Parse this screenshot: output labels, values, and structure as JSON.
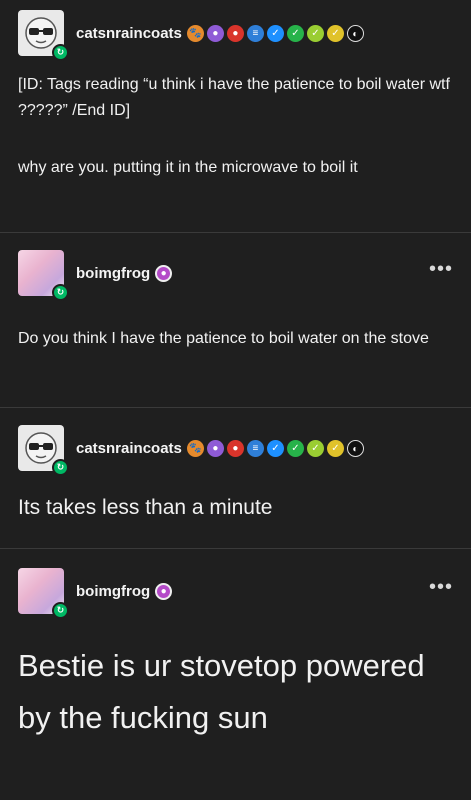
{
  "posts": [
    {
      "username": "catsnraincoats",
      "badges": [
        {
          "icon": "paw-badge-icon",
          "color": "#e58a2d",
          "glyph": "🐾"
        },
        {
          "icon": "purple-circle-badge-icon",
          "color": "#8f5bd6",
          "glyph": "●"
        },
        {
          "icon": "red-sticker-badge-icon",
          "color": "#d9342b",
          "glyph": "●"
        },
        {
          "icon": "blue-stack-badge-icon",
          "color": "#2f7fd8",
          "glyph": "≡"
        },
        {
          "icon": "blue-check-badge-icon",
          "color": "#1e90ff",
          "glyph": "✓"
        },
        {
          "icon": "green-check-badge-icon",
          "color": "#27b34a",
          "glyph": "✓"
        },
        {
          "icon": "lime-check-badge-icon",
          "color": "#9acd32",
          "glyph": "✓"
        },
        {
          "icon": "yellow-check-badge-icon",
          "color": "#e0c22a",
          "glyph": "✓"
        },
        {
          "icon": "moon-badge-icon",
          "color": "#111111",
          "glyph": "◐"
        }
      ],
      "paragraphs": [
        "[ID: Tags reading “u think i have the patience to boil water wtf ?????” /End ID]",
        "why are you. putting it in the microwave to boil it"
      ]
    },
    {
      "username": "boimgfrog",
      "badges": [
        {
          "icon": "pink-ghost-badge-icon",
          "color": "#b44ac8",
          "glyph": "●"
        }
      ],
      "paragraphs": [
        "Do you think I have the patience to boil water on the stove"
      ]
    },
    {
      "username": "catsnraincoats",
      "badges": [
        {
          "icon": "paw-badge-icon",
          "color": "#e58a2d",
          "glyph": "🐾"
        },
        {
          "icon": "purple-circle-badge-icon",
          "color": "#8f5bd6",
          "glyph": "●"
        },
        {
          "icon": "red-sticker-badge-icon",
          "color": "#d9342b",
          "glyph": "●"
        },
        {
          "icon": "blue-stack-badge-icon",
          "color": "#2f7fd8",
          "glyph": "≡"
        },
        {
          "icon": "blue-check-badge-icon",
          "color": "#1e90ff",
          "glyph": "✓"
        },
        {
          "icon": "green-check-badge-icon",
          "color": "#27b34a",
          "glyph": "✓"
        },
        {
          "icon": "lime-check-badge-icon",
          "color": "#9acd32",
          "glyph": "✓"
        },
        {
          "icon": "yellow-check-badge-icon",
          "color": "#e0c22a",
          "glyph": "✓"
        },
        {
          "icon": "moon-badge-icon",
          "color": "#111111",
          "glyph": "◐"
        }
      ],
      "paragraphs": [
        "Its takes less than a minute"
      ]
    },
    {
      "username": "boimgfrog",
      "badges": [
        {
          "icon": "pink-ghost-badge-icon",
          "color": "#b44ac8",
          "glyph": "●"
        }
      ],
      "paragraphs": [
        "Bestie is ur stovetop powered by the fucking sun"
      ]
    }
  ],
  "menu_glyph": "•••",
  "reblog_glyph": "↻"
}
